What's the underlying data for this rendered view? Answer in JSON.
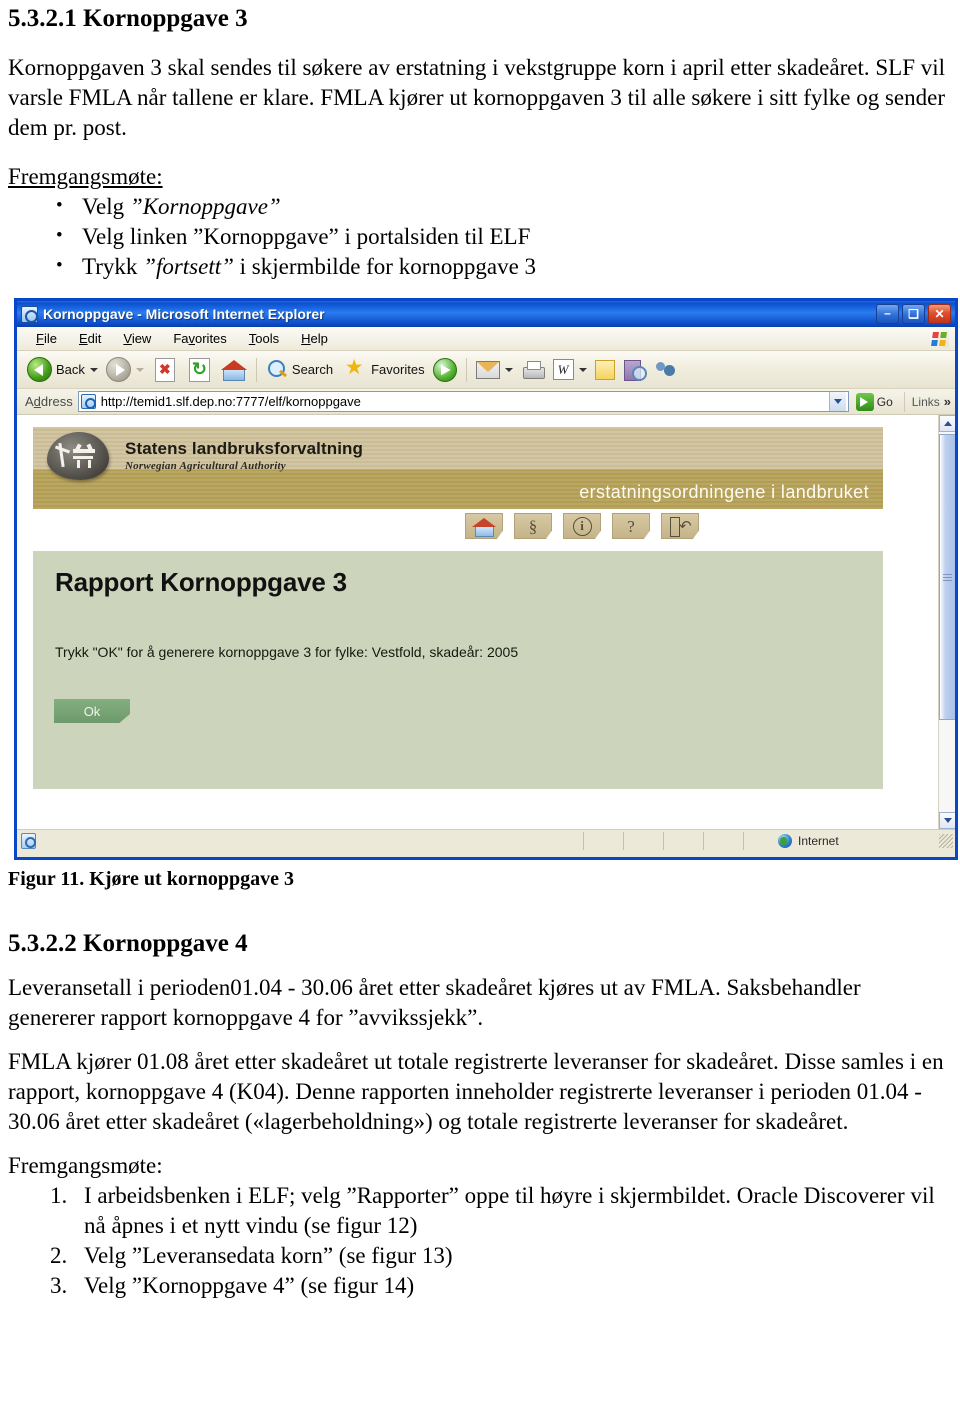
{
  "document": {
    "heading1": "5.3.2.1 Kornoppgave 3",
    "para1": "Kornoppgaven 3 skal sendes til søkere av erstatning i vekstgruppe korn i april etter skadeåret. SLF vil varsle FMLA når tallene er klare. FMLA kjører ut kornoppgaven 3 til alle søkere i sitt fylke og sender dem pr. post.",
    "fremgangsmote_label_1": "Fremgangsmøte:",
    "bullets": [
      {
        "pre": "Velg ",
        "quoted": "”Kornoppgave”",
        "post": ""
      },
      {
        "pre": "Velg linken ”Kornoppgave” i portalsiden til ELF",
        "quoted": "",
        "post": ""
      },
      {
        "pre": "Trykk ",
        "quoted": "”fortsett”",
        "post": " i skjermbilde for kornoppgave 3"
      }
    ],
    "figure_caption": "Figur 11. Kjøre ut kornoppgave 3",
    "heading2": "5.3.2.2 Kornoppgave 4",
    "para2": "Leveransetall i perioden01.04 - 30.06 året etter skadeåret kjøres ut av FMLA. Saksbehandler genererer rapport kornoppgave 4 for ”avvikssjekk”.",
    "para3": "FMLA kjører 01.08 året etter skadeåret ut totale registrerte leveranser for skadeåret. Disse samles i en rapport, kornoppgave 4 (K04). Denne rapporten inneholder registrerte leveranser i perioden 01.04 - 30.06 året etter skadeåret («lagerbeholdning») og totale registrerte leveranser for skadeåret.",
    "fremgangsmote_label_2": "Fremgangsmøte:",
    "numbered": [
      "I arbeidsbenken i ELF; velg ”Rapporter” oppe til høyre i skjermbildet.  Oracle Discoverer vil nå åpnes i et nytt vindu (se figur 12)",
      "Velg ”Leveransedata korn” (se figur 13)",
      "Velg ”Kornoppgave 4” (se figur 14)"
    ]
  },
  "browser": {
    "title": "Kornoppgave - Microsoft Internet Explorer",
    "window_buttons": {
      "minimize": "–",
      "maximize": "❑",
      "close": "✕"
    },
    "menu": [
      {
        "accel": "F",
        "rest": "ile"
      },
      {
        "accel": "E",
        "rest": "dit"
      },
      {
        "accel": "V",
        "rest": "iew"
      },
      {
        "pre": "Fa",
        "accel": "v",
        "rest": "orites"
      },
      {
        "accel": "T",
        "rest": "ools"
      },
      {
        "accel": "H",
        "rest": "elp"
      }
    ],
    "toolbar": {
      "back_label": "Back",
      "search_label": "Search",
      "favorites_label": "Favorites"
    },
    "address": {
      "label": "Address",
      "url": "http://temid1.slf.dep.no:7777/elf/kornoppgave",
      "go_label": "Go",
      "links_label": "Links",
      "overflow": "»"
    },
    "statusbar": {
      "zone": "Internet"
    }
  },
  "webpage": {
    "banner": {
      "org_name": "Statens landbruksforvaltning",
      "org_name_en": "Norwegian Agricultural Authority",
      "slogan": "erstatningsordningene i landbruket"
    },
    "nav_icons": [
      {
        "name": "home",
        "glyph": ""
      },
      {
        "name": "paragraph",
        "glyph": "§"
      },
      {
        "name": "info",
        "glyph": "i"
      },
      {
        "name": "help",
        "glyph": "?"
      },
      {
        "name": "logout",
        "glyph": ""
      }
    ],
    "card": {
      "title": "Rapport Kornoppgave 3",
      "message": "Trykk \"OK\" for å generere kornoppgave 3 for fylke: Vestfold, skadeår: 2005",
      "ok_label": "Ok"
    }
  },
  "colors": {
    "title_bar_blue": "#0a4fd0",
    "chrome_beige": "#ece9d8",
    "banner_light": "#cdc09a",
    "banner_dark": "#b5a057",
    "card_green": "#ccd5bb",
    "ok_button_green": "#6d9a6c",
    "tan_button": "#c5b489"
  }
}
